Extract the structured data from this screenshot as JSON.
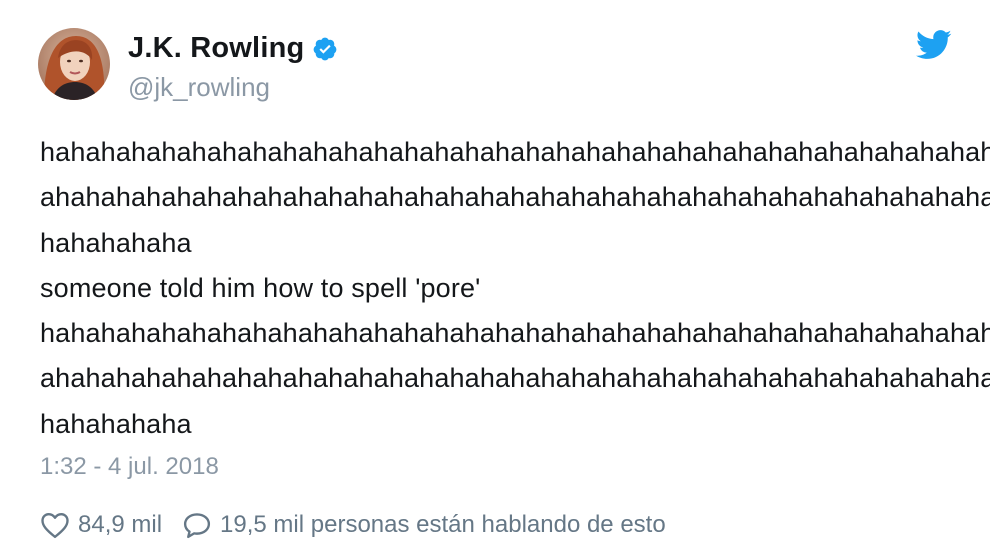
{
  "user": {
    "display_name": "J.K. Rowling",
    "handle": "@jk_rowling",
    "verified": true,
    "avatar_icon": "profile-photo"
  },
  "brand": {
    "icon": "twitter-bird-icon",
    "color": "#1da1f2"
  },
  "tweet": {
    "lines": [
      "hahahahahahahahahahahahahahahahahahahahahahahahahahahahahahahah",
      "ahahahahahahahahahahahahahahahahahahahahahahahahahahahahahahaha",
      "hahahahaha",
      "someone told him how to spell 'pore'",
      "hahahahahahahahahahahahahahahahahahahahahahahahahahahahahahahah",
      "ahahahahahahahahahahahahahahahahahahahahahahahahahahahahahahaha",
      "hahahahaha"
    ],
    "timestamp": "1:32 - 4 jul. 2018"
  },
  "actions": {
    "like_icon": "heart-icon",
    "like_count": "84,9 mil",
    "reply_icon": "speech-bubble-icon",
    "reply_text": "19,5 mil personas están hablando de esto"
  },
  "colors": {
    "text": "#14171a",
    "secondary": "#8b98a5",
    "verified": "#1da1f2"
  }
}
